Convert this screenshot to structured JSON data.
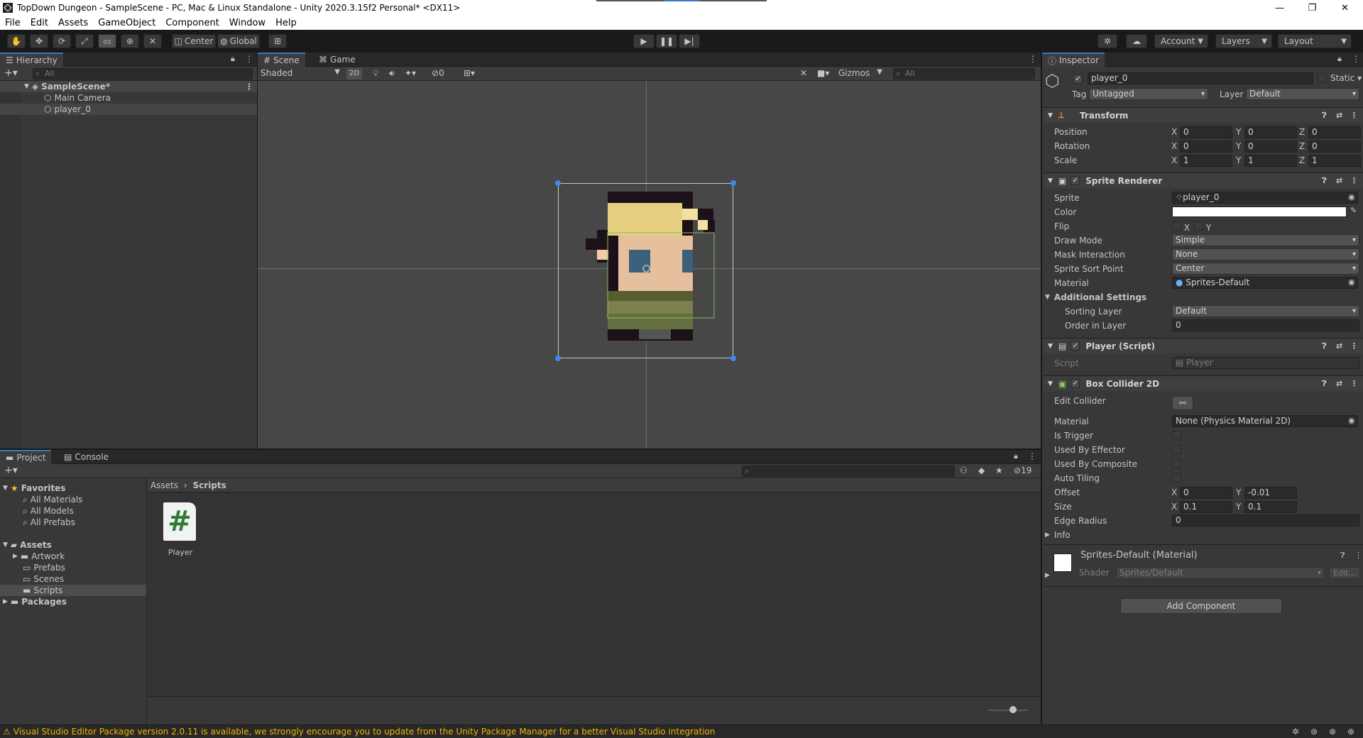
{
  "window": {
    "title": "TopDown Dungeon - SampleScene - PC, Mac & Linux Standalone - Unity 2020.3.15f2 Personal* <DX11>"
  },
  "menu": [
    "File",
    "Edit",
    "Assets",
    "GameObject",
    "Component",
    "Window",
    "Help"
  ],
  "toolbar": {
    "center_label": "Center",
    "global_label": "Global",
    "account_label": "Account",
    "layers_label": "Layers",
    "layout_label": "Layout"
  },
  "hierarchy": {
    "tab": "Hierarchy",
    "search_placeholder": "All",
    "scene": "SampleScene*",
    "items": [
      "Main Camera",
      "player_0"
    ]
  },
  "scene": {
    "tabs": [
      "Scene",
      "Game"
    ],
    "shading": "Shaded",
    "mode_2d": "2D",
    "hidden_count": "0",
    "gizmos": "Gizmos",
    "search_placeholder": "All"
  },
  "project": {
    "tabs": [
      "Project",
      "Console"
    ],
    "favorites_label": "Favorites",
    "favorites": [
      "All Materials",
      "All Models",
      "All Prefabs"
    ],
    "assets_label": "Assets",
    "folders": [
      "Artwork",
      "Prefabs",
      "Scenes",
      "Scripts"
    ],
    "packages_label": "Packages",
    "breadcrumb": [
      "Assets",
      "Scripts"
    ],
    "files": [
      {
        "name": "Player",
        "icon": "csharp-script-icon"
      }
    ],
    "count": "19"
  },
  "status": {
    "message": "Visual Studio Editor Package version 2.0.11 is available, we strongly encourage you to update from the Unity Package Manager for a better Visual Studio integration"
  },
  "inspector": {
    "tab": "Inspector",
    "object_name": "player_0",
    "static_label": "Static",
    "tag_label": "Tag",
    "tag": "Untagged",
    "layer_label": "Layer",
    "layer": "Default",
    "transform": {
      "title": "Transform",
      "rows": [
        {
          "label": "Position",
          "x": "0",
          "y": "0",
          "z": "0"
        },
        {
          "label": "Rotation",
          "x": "0",
          "y": "0",
          "z": "0"
        },
        {
          "label": "Scale",
          "x": "1",
          "y": "1",
          "z": "1"
        }
      ]
    },
    "sprite_renderer": {
      "title": "Sprite Renderer",
      "sprite_label": "Sprite",
      "sprite": "player_0",
      "color_label": "Color",
      "color": "#ffffff",
      "flip_label": "Flip",
      "flip_x": "X",
      "flip_y": "Y",
      "draw_mode_label": "Draw Mode",
      "draw_mode": "Simple",
      "mask_label": "Mask Interaction",
      "mask": "None",
      "sort_point_label": "Sprite Sort Point",
      "sort_point": "Center",
      "material_label": "Material",
      "material": "Sprites-Default",
      "additional_label": "Additional Settings",
      "sorting_layer_label": "Sorting Layer",
      "sorting_layer": "Default",
      "order_label": "Order in Layer",
      "order": "0"
    },
    "player_script": {
      "title": "Player (Script)",
      "script_label": "Script",
      "script": "Player"
    },
    "box_collider": {
      "title": "Box Collider 2D",
      "edit_label": "Edit Collider",
      "material_label": "Material",
      "material": "None (Physics Material 2D)",
      "trigger_label": "Is Trigger",
      "effector_label": "Used By Effector",
      "composite_label": "Used By Composite",
      "tiling_label": "Auto Tiling",
      "offset_label": "Offset",
      "offset_x": "0",
      "offset_y": "-0.01",
      "size_label": "Size",
      "size_x": "0.1",
      "size_y": "0.1",
      "edge_label": "Edge Radius",
      "edge": "0",
      "info_label": "Info"
    },
    "material_section": {
      "title": "Sprites-Default (Material)",
      "shader_label": "Shader",
      "shader": "Sprites/Default",
      "edit_label": "Edit..."
    },
    "add_component": "Add Component"
  },
  "colors": {
    "accent": "#3a79bb",
    "panel": "#383838",
    "header": "#282828",
    "selection": "#4d4d4d"
  }
}
